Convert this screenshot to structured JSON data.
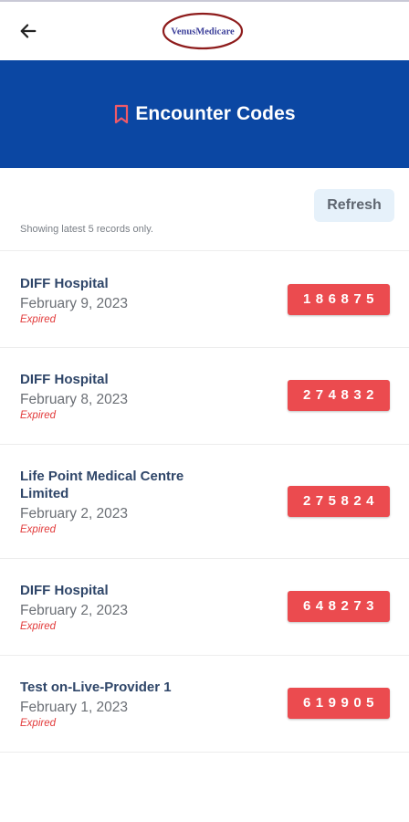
{
  "app": {
    "logo_text": "VenusMedicare",
    "page_title": "Encounter Codes"
  },
  "toolbar": {
    "refresh_label": "Refresh",
    "records_note": "Showing latest 5 records only."
  },
  "colors": {
    "banner": "#0b47a3",
    "code_badge": "#eb4b4f",
    "expired_text": "#e23b3b",
    "provider_text": "#2f4669",
    "refresh_bg": "#e6f1fa"
  },
  "icons": {
    "back": "arrow-left-icon",
    "title": "bookmark-icon"
  },
  "encounters": [
    {
      "provider": "DIFF Hospital",
      "date": "February 9, 2023",
      "status": "Expired",
      "code": "186875"
    },
    {
      "provider": "DIFF Hospital",
      "date": "February 8, 2023",
      "status": "Expired",
      "code": "274832"
    },
    {
      "provider": "Life Point Medical Centre Limited",
      "date": "February 2, 2023",
      "status": "Expired",
      "code": "275824"
    },
    {
      "provider": "DIFF Hospital",
      "date": "February 2, 2023",
      "status": "Expired",
      "code": "648273"
    },
    {
      "provider": "Test on-Live-Provider 1",
      "date": "February 1, 2023",
      "status": "Expired",
      "code": "619905"
    }
  ]
}
